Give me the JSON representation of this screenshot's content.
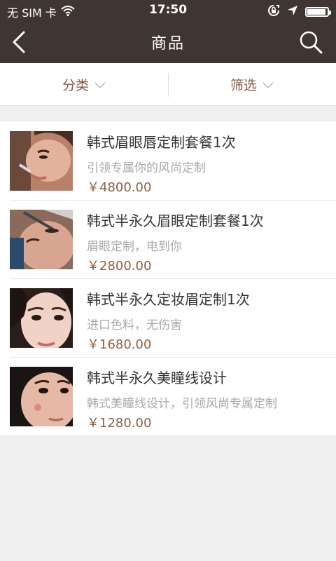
{
  "status_bar": {
    "carrier": "无 SIM 卡",
    "time": "17:50",
    "battery_level": 0.92
  },
  "nav": {
    "title": "商品",
    "back_icon": "chevron-left-icon",
    "search_icon": "search-icon"
  },
  "filters": {
    "category_label": "分类",
    "filter_label": "筛选"
  },
  "colors": {
    "header_bg": "#3f3632",
    "accent": "#8a5a43",
    "price": "#8a6146"
  },
  "products": [
    {
      "title": "韩式眉眼唇定制套餐1次",
      "desc": "引领专属你的风尚定制",
      "price": "￥4800.00"
    },
    {
      "title": "韩式半永久眉眼定制套餐1次",
      "desc": "眉眼定制，电到你",
      "price": "￥2800.00"
    },
    {
      "title": "韩式半永久定妆眉定制1次",
      "desc": "进口色料，无伤害",
      "price": "￥1680.00"
    },
    {
      "title": "韩式半永久美瞳线设计",
      "desc": "韩式美瞳线设计，引领风尚专属定制",
      "price": "￥1280.00"
    }
  ]
}
